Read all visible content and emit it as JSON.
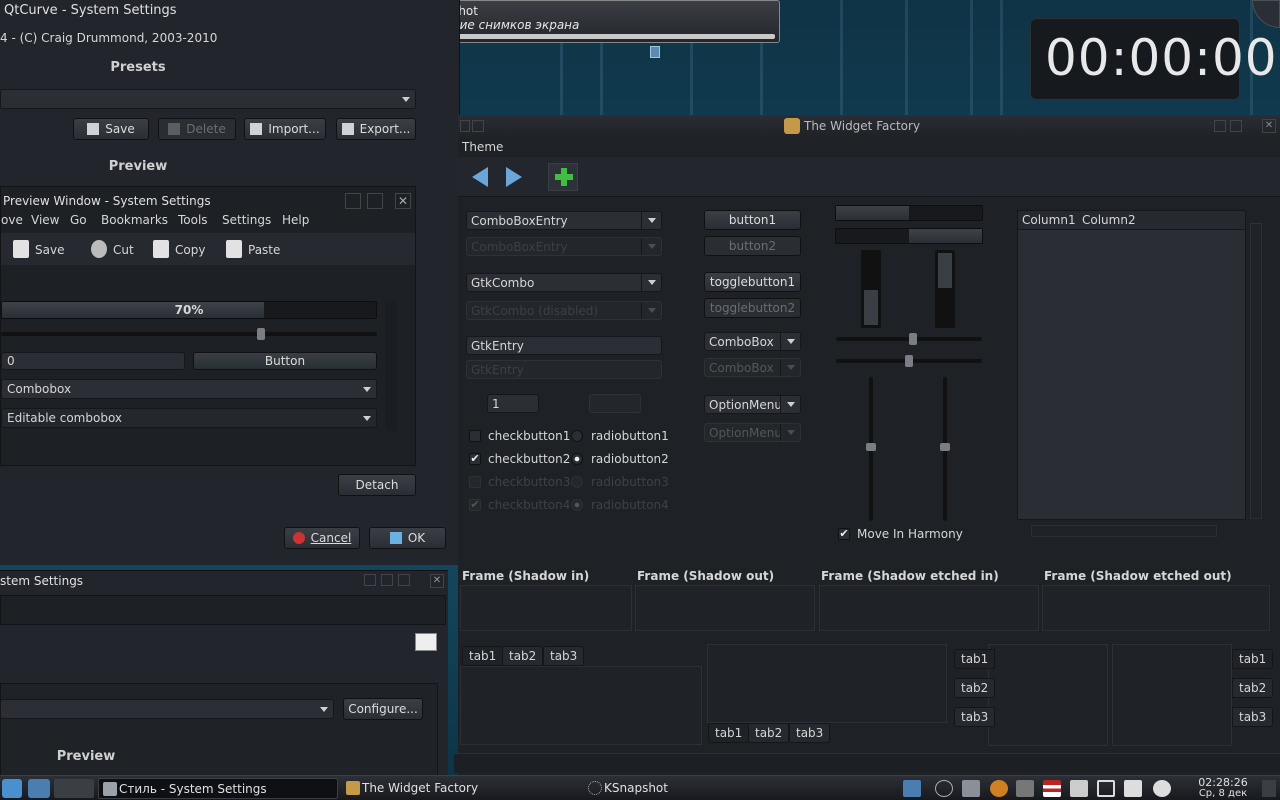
{
  "desktop": {},
  "notification": {
    "app": "KSnapshot",
    "message": "Создание снимков экрана"
  },
  "clock_widget": {
    "time": "00:00:00"
  },
  "settings_window": {
    "title": "QtCurve - System Settings",
    "version_line": "4 - (C) Craig Drummond, 2003-2010",
    "presets_header": "Presets",
    "buttons": {
      "save": "Save",
      "delete": "Delete",
      "import": "Import...",
      "export": "Export..."
    },
    "preview_header": "Preview",
    "preview_window": {
      "title": "Preview Window - System Settings",
      "menu": [
        "ove",
        "View",
        "Go",
        "Bookmarks",
        "Tools",
        "Settings",
        "Help"
      ],
      "toolbar": [
        "Save",
        "Cut",
        "Copy",
        "Paste"
      ],
      "progress_label": "70%",
      "progress": 0.7,
      "spin_value": "0",
      "button": "Button",
      "combobox": "Combobox",
      "editable_combobox": "Editable combobox"
    },
    "detach": "Detach",
    "cancel": "Cancel",
    "ok": "OK"
  },
  "settings_window2": {
    "title": "stem Settings",
    "configure": "Configure...",
    "preview_header": "Preview"
  },
  "widget_factory": {
    "title": "The Widget Factory",
    "menu": "Theme",
    "combo_entry": "ComboBoxEntry",
    "combo_entry_dis": "ComboBoxEntry",
    "gtk_combo": "GtkCombo",
    "gtk_combo_dis": "GtkCombo (disabled)",
    "gtk_entry": "GtkEntry",
    "gtk_entry_dis": "GtkEntry",
    "spin_value": "1",
    "checks": [
      {
        "label": "checkbutton1",
        "checked": false,
        "disabled": false
      },
      {
        "label": "checkbutton2",
        "checked": true,
        "disabled": false
      },
      {
        "label": "checkbutton3",
        "checked": false,
        "disabled": true
      },
      {
        "label": "checkbutton4",
        "checked": true,
        "disabled": true
      }
    ],
    "radios": [
      {
        "label": "radiobutton1",
        "selected": false,
        "disabled": false
      },
      {
        "label": "radiobutton2",
        "selected": true,
        "disabled": false
      },
      {
        "label": "radiobutton3",
        "selected": false,
        "disabled": true
      },
      {
        "label": "radiobutton4",
        "selected": true,
        "disabled": true
      }
    ],
    "button1": "button1",
    "button2": "button2",
    "toggle1": "togglebutton1",
    "toggle2": "togglebutton2",
    "combobox": "ComboBox",
    "combobox_dis": "ComboBox",
    "optionmenu": "OptionMenu",
    "optionmenu_dis": "OptionMenu",
    "move_in_harmony": "Move In Harmony",
    "columns": [
      "Column1",
      "Column2"
    ],
    "frames": [
      "Frame (Shadow in)",
      "Frame (Shadow out)",
      "Frame (Shadow etched in)",
      "Frame (Shadow etched out)"
    ],
    "tabs": [
      "tab1",
      "tab2",
      "tab3"
    ]
  },
  "taskbar": {
    "tasks": [
      "Стиль - System Settings",
      "The Widget Factory",
      "KSnapshot"
    ],
    "time": "02:28:26",
    "date": "Ср, 8 дек"
  }
}
